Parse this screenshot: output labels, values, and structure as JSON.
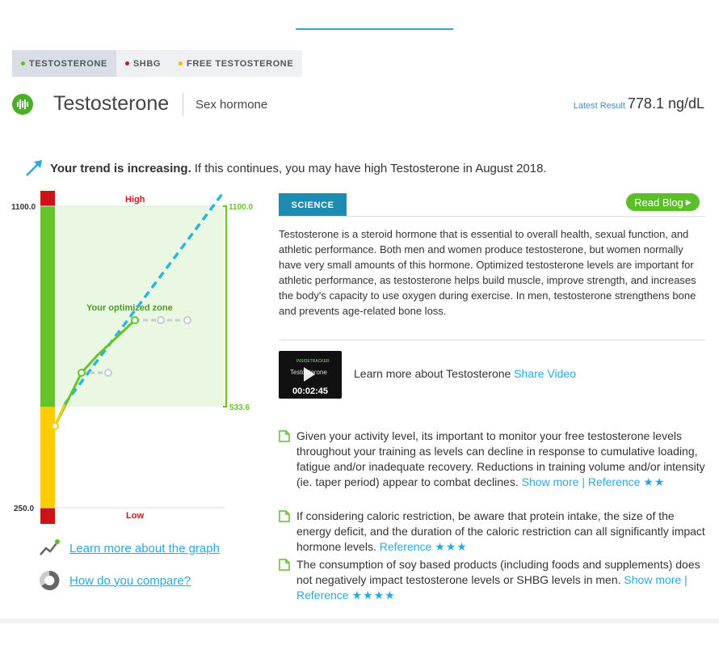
{
  "tabs": [
    {
      "label": "TESTOSTERONE",
      "color": "#5cbf2a",
      "active": true
    },
    {
      "label": "SHBG",
      "color": "#c8102e",
      "active": false
    },
    {
      "label": "FREE TESTOSTERONE",
      "color": "#f5b800",
      "active": false
    }
  ],
  "header": {
    "title": "Testosterone",
    "subtitle": "Sex hormone",
    "latest_label": "Latest Result",
    "latest_value": "778.1 ng/dL"
  },
  "trend": {
    "bold": "Your trend is increasing.",
    "text": "If this continues, you may have high Testosterone in August 2018."
  },
  "graph": {
    "top_value": "1100.0",
    "bottom_value": "250.0",
    "high_label": "High",
    "low_label": "Low",
    "zone_label": "Your optimized zone",
    "zone_top": "1100.0",
    "zone_bottom": "533.6",
    "colors": {
      "green": "#66c42a",
      "yellow": "#ffcc00",
      "red": "#cc1418",
      "trend": "#29b6d9",
      "zone": "#eaf7e2"
    }
  },
  "links": {
    "learn_graph": "Learn more about the graph",
    "compare": "How do you compare?"
  },
  "science": {
    "tab_label": "SCIENCE",
    "read_blog": "Read Blog",
    "text": "Testosterone is a steroid hormone that is essential to overall health, sexual function, and athletic performance. Both men and women produce testosterone, but women normally have very small amounts of this hormone. Optimized testosterone levels are important for athletic performance, as testosterone helps build muscle, improve strength, and increases the body's capacity to use oxygen during exercise. In men, testosterone strengthens bone and prevents age-related bone loss."
  },
  "video": {
    "thumb_brand": "INSIDETRACKER",
    "thumb_title": "Testosterone",
    "duration": "00:02:45",
    "desc": "Learn more about Testosterone",
    "share": "Share Video"
  },
  "tips": [
    {
      "text": "Given your activity level, its important to monitor your free testosterone levels throughout your training as levels can decline in response to cumulative loading, fatigue and/or inadequate recovery. Reductions in training volume and/or intensity (ie. taper period) appear to combat declines.",
      "show_more": "Show more",
      "sep": "|",
      "reference": "Reference",
      "stars": "★★"
    },
    {
      "text": "If considering caloric restriction, be aware that protein intake, the size of the energy deficit, and the duration of the caloric restriction can all significantly impact hormone levels.",
      "show_more": "",
      "sep": "",
      "reference": "Reference",
      "stars": "★★★"
    },
    {
      "text": "The consumption of soy based products (including foods and supplements) does not negatively impact testosterone levels or SHBG levels in men.",
      "show_more": "Show more",
      "sep": "|",
      "reference": "Reference",
      "stars": "★★★★"
    }
  ]
}
